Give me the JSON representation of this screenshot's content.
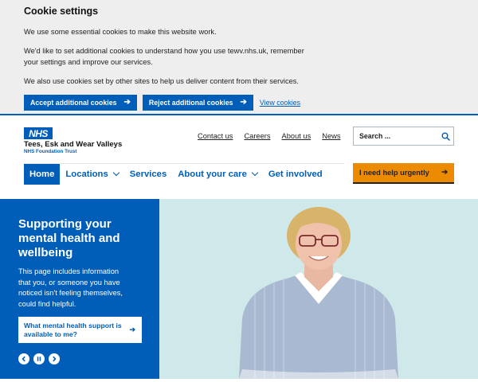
{
  "cookie": {
    "title": "Cookie settings",
    "p1": "We use some essential cookies to make this website work.",
    "p2a": "We'd like to set additional cookies to understand how you use tewv.nhs.uk, remember",
    "p2b": "your settings and improve our services.",
    "p3": "We also use cookies set by other sites to help us deliver content from their services.",
    "accept": "Accept additional cookies",
    "reject": "Reject additional cookies",
    "view": "View cookies"
  },
  "logo": {
    "nhs": "NHS",
    "name": "Tees, Esk and Wear Valleys",
    "sub": "NHS Foundation Trust"
  },
  "toplinks": [
    "Contact us",
    "Careers",
    "About us",
    "News"
  ],
  "search": {
    "placeholder": "Search ..."
  },
  "nav": [
    "Home",
    "Locations",
    "Services",
    "About your care",
    "Get involved"
  ],
  "urgent": "I need help urgently",
  "hero": {
    "title_l1": "Supporting your",
    "title_l2": "mental health and",
    "title_l3": "wellbeing",
    "body_l1": "This page includes information",
    "body_l2": "that you, or someone you have",
    "body_l3": "noticed isn't feeling themselves,",
    "body_l4": "could find helpful.",
    "cta_l1": "What mental health support is",
    "cta_l2": "available to me?"
  },
  "colors": {
    "brand": "#005eb8",
    "urgent": "#ed8b00",
    "hero_bg": "#cfe8ea"
  }
}
